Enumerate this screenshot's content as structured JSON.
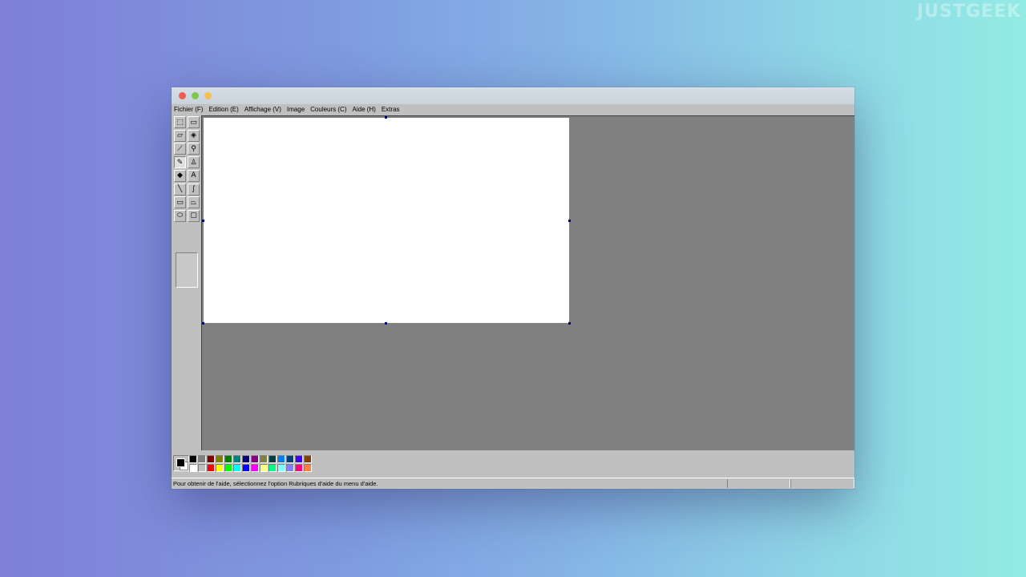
{
  "watermark": "JUSTGEEK",
  "menu": [
    "Fichier (F)",
    "Edition (E)",
    "Affichage (V)",
    "Image",
    "Couleurs (C)",
    "Aide (H)",
    "Extras"
  ],
  "tools": [
    {
      "name": "free-form-select-icon",
      "glyph": "⬚"
    },
    {
      "name": "select-icon",
      "glyph": "▭"
    },
    {
      "name": "eraser-icon",
      "glyph": "▱"
    },
    {
      "name": "fill-icon",
      "glyph": "◈"
    },
    {
      "name": "color-picker-icon",
      "glyph": "⟋"
    },
    {
      "name": "magnifier-icon",
      "glyph": "⚲"
    },
    {
      "name": "pencil-icon",
      "glyph": "✎"
    },
    {
      "name": "brush-icon",
      "glyph": "♙"
    },
    {
      "name": "airbrush-icon",
      "glyph": "◆"
    },
    {
      "name": "text-icon",
      "glyph": "A"
    },
    {
      "name": "line-icon",
      "glyph": "╲"
    },
    {
      "name": "curve-icon",
      "glyph": "∫"
    },
    {
      "name": "rectangle-icon",
      "glyph": "▭"
    },
    {
      "name": "polygon-icon",
      "glyph": "⏢"
    },
    {
      "name": "ellipse-icon",
      "glyph": "⬭"
    },
    {
      "name": "rounded-rectangle-icon",
      "glyph": "▢"
    }
  ],
  "active_tool": "pencil-icon",
  "colors": {
    "foreground": "#000000",
    "background": "#ffffff",
    "palette": [
      "#000000",
      "#808080",
      "#800000",
      "#808000",
      "#008000",
      "#008080",
      "#000080",
      "#800080",
      "#808040",
      "#004040",
      "#0080ff",
      "#004080",
      "#4000ff",
      "#804000",
      "#ffffff",
      "#c0c0c0",
      "#ff0000",
      "#ffff00",
      "#00ff00",
      "#00ffff",
      "#0000ff",
      "#ff00ff",
      "#ffff80",
      "#00ff80",
      "#80ffff",
      "#8080ff",
      "#ff0080",
      "#ff8040"
    ]
  },
  "status": {
    "help_text": "Pour obtenir de l'aide, sélectionnez l'option Rubriques d'aide du menu d'aide."
  }
}
